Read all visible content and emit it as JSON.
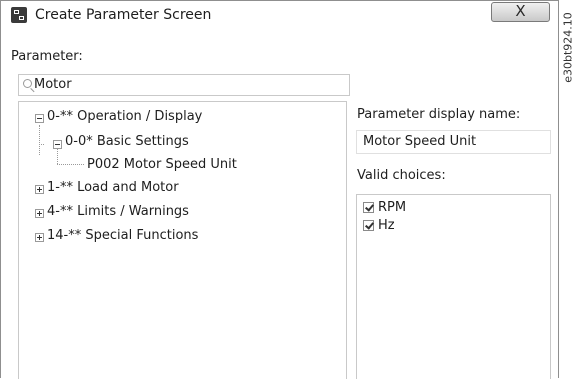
{
  "window": {
    "title": "Create Parameter Screen",
    "close_glyph": "X"
  },
  "parameter": {
    "label": "Parameter:",
    "search_value": "Motor"
  },
  "tree": {
    "group0": "0-** Operation / Display",
    "group0_child": "0-0* Basic Settings",
    "leaf": "P002 Motor Speed Unit",
    "group1": "1-** Load and Motor",
    "group4": "4-** Limits / Warnings",
    "group14": "14-** Special Functions"
  },
  "display_name": {
    "label": "Parameter display name:",
    "value": "Motor Speed Unit"
  },
  "valid_choices": {
    "label": "Valid choices:",
    "items": [
      {
        "label": "RPM",
        "checked": true
      },
      {
        "label": "Hz",
        "checked": true
      }
    ]
  },
  "image_code": "e30bt924.10"
}
